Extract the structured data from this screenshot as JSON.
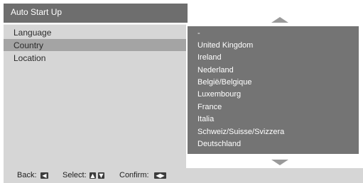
{
  "header": {
    "title": "Auto Start Up"
  },
  "menu": {
    "items": [
      {
        "label": "Language"
      },
      {
        "label": "Country"
      },
      {
        "label": "Location"
      }
    ]
  },
  "country_list": {
    "items": [
      "-",
      "United Kingdom",
      "Ireland",
      "Nederland",
      "België/Belgique",
      "Luxembourg",
      "France",
      "Italia",
      "Schweiz/Suisse/Svizzera",
      "Deutschland"
    ]
  },
  "footer": {
    "back_label": "Back:",
    "select_label": "Select:",
    "confirm_label": "Confirm:",
    "back_icon": "left-arrow-icon",
    "select_icons": [
      "up-arrow-icon",
      "down-arrow-icon"
    ],
    "confirm_icon": "enter-icon"
  },
  "colors": {
    "title_bg": "#6e6e6e",
    "panel_bg": "#d6d6d6",
    "selected_bg": "#a4a4a4",
    "list_bg": "#747474"
  }
}
